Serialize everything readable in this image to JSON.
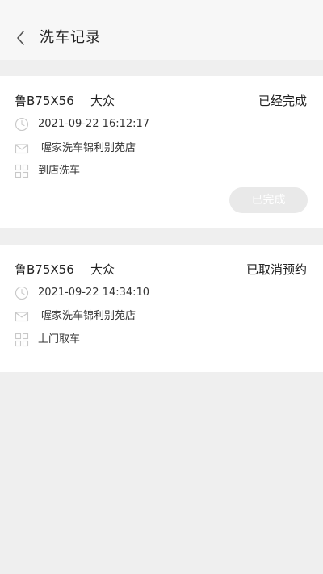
{
  "header": {
    "title": "洗车记录"
  },
  "records": [
    {
      "plate": "鲁B75X56",
      "brand": "大众",
      "status": "已经完成",
      "datetime": "2021-09-22 16:12:17",
      "shop": "喔家洗车锦利别苑店",
      "service": "到店洗车",
      "action_label": "已完成"
    },
    {
      "plate": "鲁B75X56",
      "brand": "大众",
      "status": "已取消预约",
      "datetime": "2021-09-22 14:34:10",
      "shop": "喔家洗车锦利别苑店",
      "service": "上门取车"
    }
  ],
  "icons": {
    "back": "chevron-left-icon",
    "time": "clock-icon",
    "shop": "envelope-icon",
    "service": "grid-icon"
  },
  "colors": {
    "icon_gray": "#c8c8c8",
    "button_bg": "#e9e9e9"
  }
}
